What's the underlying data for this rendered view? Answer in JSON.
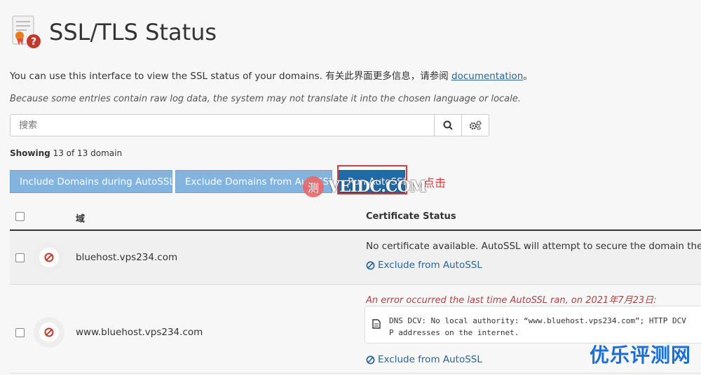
{
  "header": {
    "title": "SSL/TLS Status"
  },
  "intro": {
    "text": "You can use this interface to view the SSL status of your domains. 有关此界面更多信息，请参阅 ",
    "link": "documentation",
    "suffix": "。"
  },
  "note": "Because some entries contain raw log data, the system may not translate it into the chosen language or locale.",
  "search": {
    "placeholder": "搜索"
  },
  "showing": {
    "label": "Showing",
    "text": "13 of 13 domain"
  },
  "buttons": {
    "include": "Include Domains during AutoSSL",
    "exclude": "Exclude Domains from AutoSSL",
    "run": "Run AutoSSL"
  },
  "annotation": {
    "text": "点击"
  },
  "watermark": {
    "icon": "测",
    "text": "VEIDC.COM"
  },
  "table": {
    "headers": {
      "domain": "域",
      "status": "Certificate Status"
    },
    "rows": [
      {
        "domain": "bluehost.vps234.com",
        "status": "No certificate available. AutoSSL will attempt to secure the domain the next",
        "link": "Exclude from AutoSSL"
      },
      {
        "domain": "www.bluehost.vps234.com",
        "error_title": "An error occurred the last time AutoSSL ran, on 2021年7月23日:",
        "error_log": "DNS DCV: No local authority: “www.bluehost.vps234.com”; HTTP DCV\nP addresses on the internet.",
        "link": "Exclude from AutoSSL"
      }
    ]
  },
  "brand": "优乐评测网",
  "colors": {
    "primary": "#1f6aa8",
    "light_button": "#83b4e0",
    "error": "#c0392b",
    "link": "#2a6496",
    "annotation": "#d63a3a",
    "brand": "#1b6fd6"
  }
}
